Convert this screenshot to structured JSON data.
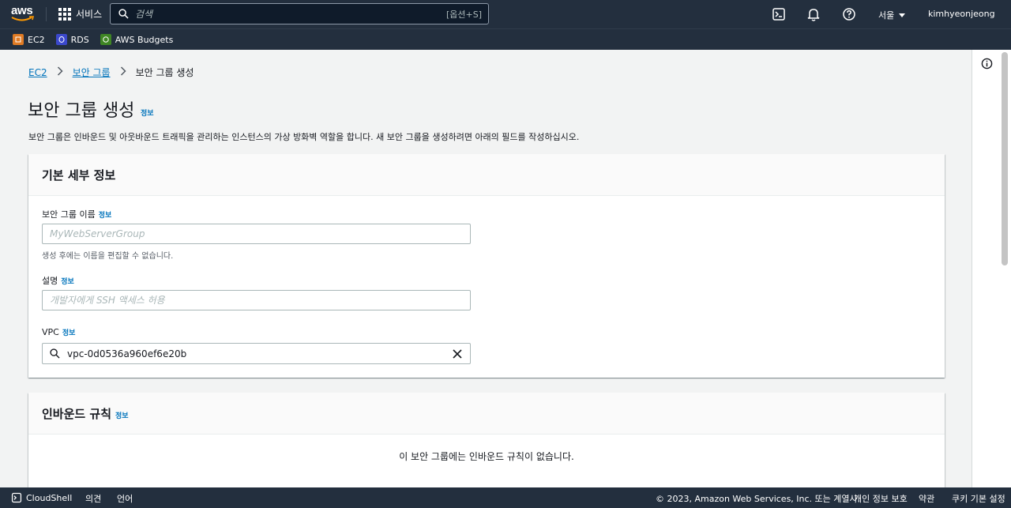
{
  "topnav": {
    "logo": "aws",
    "services_label": "서비스",
    "search_placeholder": "검색",
    "search_shortcut": "[옵션+S]",
    "region": "서울",
    "user": "kimhyeonjeong"
  },
  "favorites": [
    {
      "label": "EC2",
      "color": "#e07b24"
    },
    {
      "label": "RDS",
      "color": "#3b48cc"
    },
    {
      "label": "AWS Budgets",
      "color": "#3f8624"
    }
  ],
  "breadcrumb": {
    "items": [
      "EC2",
      "보안 그룹"
    ],
    "current": "보안 그룹 생성"
  },
  "page": {
    "title": "보안 그룹 생성",
    "title_info": "정보",
    "description": "보안 그룹은 인바운드 및 아웃바운드 트래픽을 관리하는 인스턴스의 가상 방화벽 역할을 합니다. 새 보안 그룹을 생성하려면 아래의 필드를 작성하십시오."
  },
  "basic": {
    "heading": "기본 세부 정보",
    "name_label": "보안 그룹 이름",
    "name_info": "정보",
    "name_placeholder": "MyWebServerGroup",
    "name_hint": "생성 후에는 이름을 편집할 수 없습니다.",
    "desc_label": "설명",
    "desc_info": "정보",
    "desc_placeholder": "개발자에게 SSH 액세스 허용",
    "vpc_label": "VPC",
    "vpc_info": "정보",
    "vpc_value": "vpc-0d0536a960ef6e20b"
  },
  "inbound": {
    "heading": "인바운드 규칙",
    "info": "정보",
    "empty": "이 보안 그룹에는 인바운드 규칙이 없습니다."
  },
  "footer": {
    "cloudshell": "CloudShell",
    "feedback": "의견",
    "language": "언어",
    "copyright": "© 2023, Amazon Web Services, Inc. 또는 계열사.",
    "privacy": "개인 정보 보호",
    "terms": "약관",
    "cookies": "쿠키 기본 설정"
  }
}
